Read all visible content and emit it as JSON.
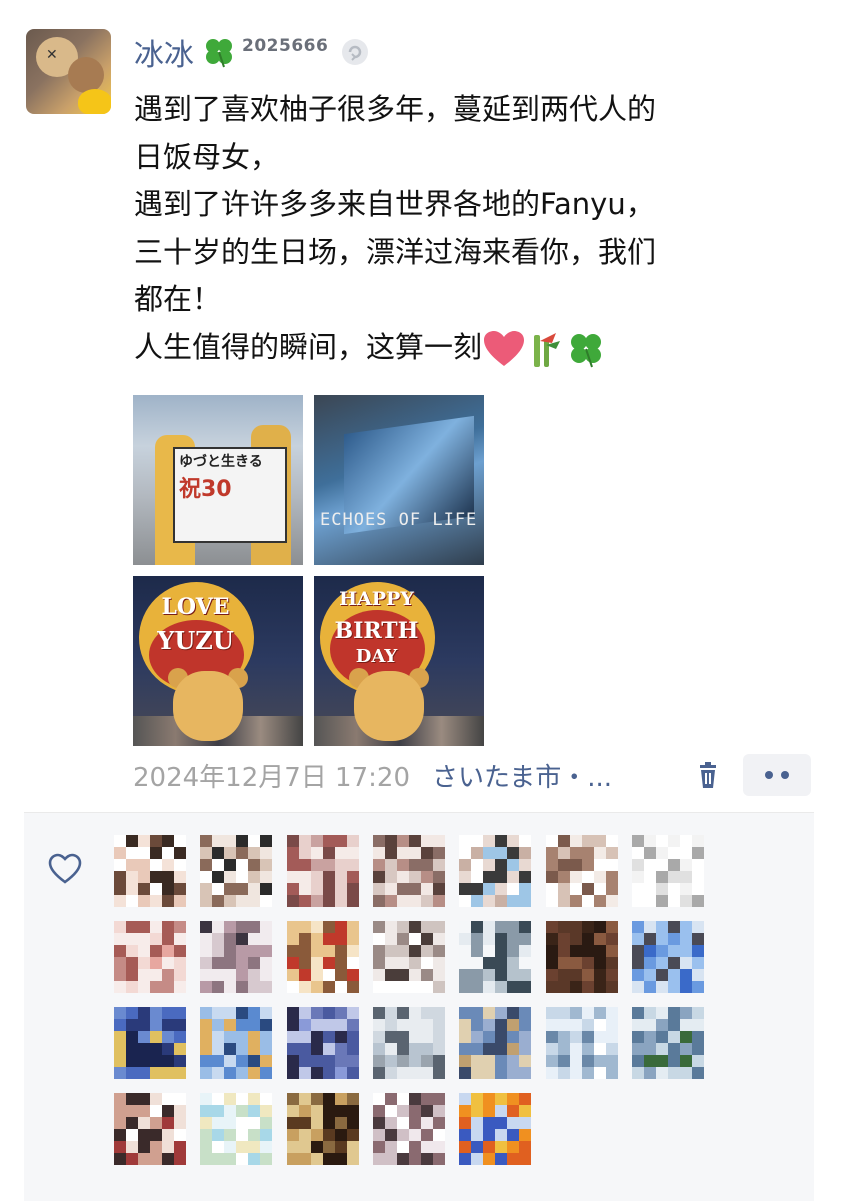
{
  "post": {
    "nickname": "冰冰",
    "badge_number": "2025666",
    "text_lines": [
      "遇到了喜欢柚子很多年，蔓延到两代人的",
      "日饭母女，",
      "遇到了许许多多来自世界各地的Fanyu，",
      "三十岁的生日场，漂洋过海来看你，我们",
      "都在！",
      "人生值得的瞬间，这算一刻"
    ],
    "timestamp": "2024年12月7日 17:20",
    "location": "さいたま市・...",
    "photos": [
      {
        "sign_line1": "ゆづと生きる",
        "sign_line2": "祝30"
      },
      {
        "caption": "ECHOES OF LIFE"
      },
      {
        "board_line1": "LOVE",
        "board_line2": "YUZU"
      },
      {
        "board_line1": "HAPPY",
        "board_line2": "BIRTH",
        "board_line3": "DAY"
      }
    ]
  },
  "icons": {
    "clover": "four-leaf-clover-icon",
    "verify": "verify-icon",
    "heart_emoji": "heart-emoji-icon",
    "bamboo_emoji": "bamboo-emoji-icon",
    "delete": "trash-icon",
    "more": "more-icon",
    "like": "heart-outline-icon"
  },
  "colors": {
    "link_blue": "#4a6290",
    "timestamp_gray": "#a4a4a4",
    "panel_bg": "#f6f7f9"
  },
  "likes_count_rows": [
    7,
    7,
    7,
    5
  ]
}
